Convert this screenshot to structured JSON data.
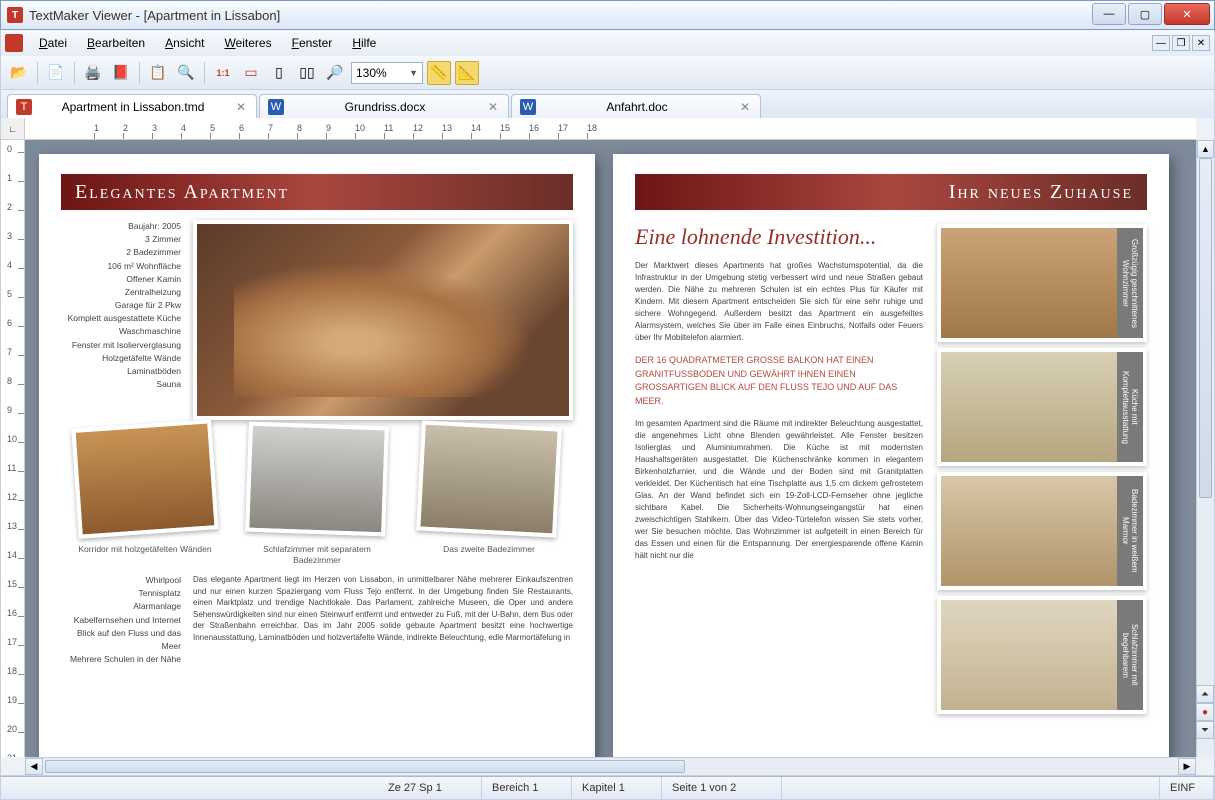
{
  "window": {
    "title": "TextMaker Viewer - [Apartment in Lissabon]"
  },
  "menu": {
    "items": [
      "Datei",
      "Bearbeiten",
      "Ansicht",
      "Weiteres",
      "Fenster",
      "Hilfe"
    ]
  },
  "toolbar": {
    "zoom": "130%"
  },
  "tabs": {
    "t0": {
      "label": "Apartment in Lissabon.tmd"
    },
    "t1": {
      "label": "Grundriss.docx"
    },
    "t2": {
      "label": "Anfahrt.doc"
    }
  },
  "page1": {
    "banner": "Elegantes Apartment",
    "features": [
      "Baujahr: 2005",
      "3 Zimmer",
      "2 Badezimmer",
      "106 m² Wohnfläche",
      "Offener Kamin",
      "Zentralheizung",
      "Garage für 2 Pkw",
      "Komplett ausgestattete Küche",
      "Waschmaschine",
      "Fenster mit Isolierverglasung",
      "Holzgetäfelte Wände",
      "Laminatböden",
      "Sauna"
    ],
    "thumb1_cap": "Korridor mit holzgetäfelten Wänden",
    "thumb2_cap": "Schlafzimmer mit separatem Badezimmer",
    "thumb3_cap": "Das zweite Badezimmer",
    "lower_left": [
      "Whirlpool",
      "Tennisplatz",
      "Alarmanlage",
      "Kabelfernsehen und Internet",
      "Blick auf den Fluss und das Meer",
      "Mehrere Schulen in der Nähe"
    ],
    "lower_right": "Das elegante Apartment liegt im Herzen von Lissabon, in unmittelbarer Nähe mehrerer Einkaufszentren und nur einen kurzen Spaziergang vom Fluss Tejo entfernt. In der Umgebung finden Sie Restaurants, einen Marktplatz und trendige Nachtlokale. Das Parlament, zahlreiche Museen, die Oper und andere Sehenswürdigkeiten sind nur einen Steinwurf entfernt und entweder zu Fuß, mit der U-Bahn, dem Bus oder der Straßenbahn erreichbar. Das im Jahr 2005 solide gebaute Apartment besitzt eine hochwertige Innenausstattung, Laminatböden und holzvertäfelte Wände, indirekte Beleuchtung, edle Marmortäfelung in"
  },
  "page2": {
    "banner": "Ihr neues Zuhause",
    "headline": "Eine lohnende Investition...",
    "para1": "Der Marktwert dieses Apartments hat großes Wachstumspotential, da die Infrastruktur in der Umgebung stetig verbessert wird und neue Straßen gebaut werden. Die Nähe zu mehreren Schulen ist ein echtes Plus für Käufer mit Kindern. Mit diesem Apartment entscheiden Sie sich für eine sehr ruhige und sichere Wohngegend. Außerdem besitzt das Apartment ein ausgefeiltes Alarmsystem, welches Sie über im Falle eines Einbruchs, Notfalls oder Feuers über Ihr Mobiltelefon alarmiert.",
    "callout": "DER 16 QUADRATMETER GROSSE BALKON HAT EINEN GRANITFUSSBODEN UND GEWÄHRT IHNEN EINEN GROSSARTIGEN BLICK AUF DEN FLUSS TEJO UND AUF DAS MEER.",
    "para2": "Im gesamten Apartment sind die Räume mit indirekter Beleuchtung ausgestattet, die angenehmes Licht ohne Blenden gewährleistet. Alle Fenster besitzen Isolierglas und Aluminiumrahmen. Die Küche ist mit modernsten Haushaltsgeräten ausgestattet. Die Küchenschränke kommen in elegantem Birkenholzfurnier, und die Wände und der Boden sind mit Granitplatten verkleidet. Der Küchentisch hat eine Tischplatte aus 1,5 cm dickem gefrostetem Glas. An der Wand befindet sich ein 19-Zoll-LCD-Fernseher ohne jegliche sichtbare Kabel. Die Sicherheits-Wohnungseingangstür hat einen zweischichtigen Stahlkern. Über das Video-Türtelefon wissen Sie stets vorher, wer Sie besuchen möchte. Das Wohnzimmer ist aufgeteilt in einen Bereich für das Essen und einen für die Entspannung. Der energiesparende offene Kamin hält nicht nur die",
    "cards": {
      "c0": "Großzügig geschnittenes Wohnzimmer",
      "c1": "Küche mit Komplettausstattung",
      "c2": "Badezimmer in weißem Marmor",
      "c3": "Schlafzimmer mit begehbarem"
    }
  },
  "status": {
    "pos": "Ze 27 Sp 1",
    "bereich": "Bereich 1",
    "kapitel": "Kapitel 1",
    "seite": "Seite 1 von 2",
    "mode": "EINF"
  }
}
